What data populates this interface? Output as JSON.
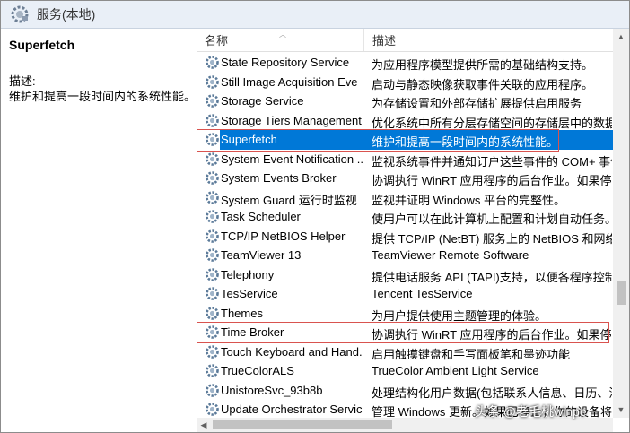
{
  "window": {
    "title": "服务(本地)"
  },
  "detail": {
    "service_name": "Superfetch",
    "desc_label": "描述:",
    "desc_text": "维护和提高一段时间内的系统性能。"
  },
  "columns": {
    "name": "名称",
    "description": "描述"
  },
  "services": [
    {
      "name": "State Repository Service",
      "desc": "为应用程序模型提供所需的基础结构支持。"
    },
    {
      "name": "Still Image Acquisition Eve",
      "desc": "启动与静态映像获取事件关联的应用程序。"
    },
    {
      "name": "Storage Service",
      "desc": "为存储设置和外部存储扩展提供启用服务"
    },
    {
      "name": "Storage Tiers Management",
      "desc": "优化系统中所有分层存储空间的存储层中的数据放"
    },
    {
      "name": "Superfetch",
      "desc": "维护和提高一段时间内的系统性能。",
      "selected": true
    },
    {
      "name": "System Event Notification ...",
      "desc": "监视系统事件并通知订户这些事件的 COM+ 事件"
    },
    {
      "name": "System Events Broker",
      "desc": "协调执行 WinRT 应用程序的后台作业。如果停止"
    },
    {
      "name": "System Guard 运行时监视",
      "desc": "监视并证明 Windows 平台的完整性。"
    },
    {
      "name": "Task Scheduler",
      "desc": "使用户可以在此计算机上配置和计划自动任务。此"
    },
    {
      "name": "TCP/IP NetBIOS Helper",
      "desc": "提供 TCP/IP (NetBT) 服务上的 NetBIOS 和网络上"
    },
    {
      "name": "TeamViewer 13",
      "desc": "TeamViewer Remote Software"
    },
    {
      "name": "Telephony",
      "desc": "提供电话服务 API (TAPI)支持，以便各程序控制本"
    },
    {
      "name": "TesService",
      "desc": "Tencent TesService"
    },
    {
      "name": "Themes",
      "desc": "为用户提供使用主题管理的体验。"
    },
    {
      "name": "Time Broker",
      "desc": "协调执行 WinRT 应用程序的后台作业。如果停止"
    },
    {
      "name": "Touch Keyboard and Hand...",
      "desc": "启用触摸键盘和手写面板笔和墨迹功能"
    },
    {
      "name": "TrueColorALS",
      "desc": "TrueColor Ambient Light Service"
    },
    {
      "name": "UnistoreSvc_93b8b",
      "desc": "处理结构化用户数据(包括联系人信息、日历、消息"
    },
    {
      "name": "Update Orchestrator Service",
      "desc": "管理 Windows 更新。如果已停止，你的设备将无法"
    }
  ],
  "watermark": "头条 @老毛桃winpe",
  "colors": {
    "selection": "#0078d7",
    "highlight_box": "#d9534f",
    "titlebar": "#e9eff7"
  },
  "icons": {
    "title": "services-gear-icon",
    "row": "gear-icon"
  }
}
